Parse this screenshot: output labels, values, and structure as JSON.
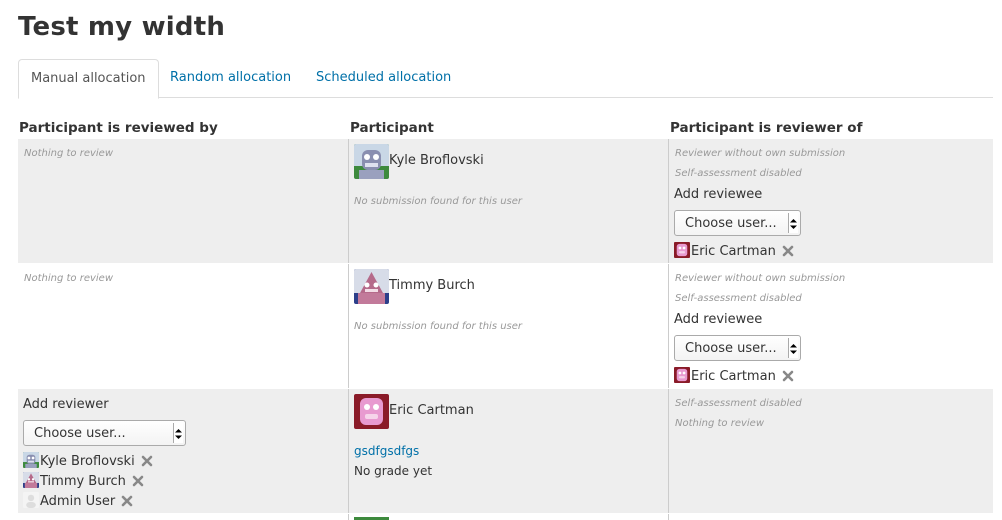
{
  "page": {
    "title": "Test my width"
  },
  "tabs": [
    {
      "label": "Manual allocation",
      "active": true
    },
    {
      "label": "Random allocation",
      "active": false
    },
    {
      "label": "Scheduled allocation",
      "active": false
    }
  ],
  "headers": {
    "reviewed_by": "Participant is reviewed by",
    "participant": "Participant",
    "reviewer_of": "Participant is reviewer of"
  },
  "rows": [
    {
      "reviewed_by": {
        "note": "Nothing to review"
      },
      "participant": {
        "name": "Kyle Broflovski",
        "submission_note": "No submission found for this user",
        "avatar": "robot-grey-icon"
      },
      "reviewer_of": {
        "notes": [
          "Reviewer without own submission",
          "Self-assessment disabled"
        ],
        "add_label": "Add reviewee",
        "select_value": "Choose user...",
        "assigned": [
          {
            "name": "Eric Cartman",
            "avatar": "robot-pink-icon"
          }
        ]
      }
    },
    {
      "reviewed_by": {
        "note": "Nothing to review"
      },
      "participant": {
        "name": "Timmy Burch",
        "submission_note": "No submission found for this user",
        "avatar": "robot-red-icon"
      },
      "reviewer_of": {
        "notes": [
          "Reviewer without own submission",
          "Self-assessment disabled"
        ],
        "add_label": "Add reviewee",
        "select_value": "Choose user...",
        "assigned": [
          {
            "name": "Eric Cartman",
            "avatar": "robot-pink-icon"
          }
        ]
      }
    },
    {
      "reviewed_by": {
        "add_label": "Add reviewer",
        "select_value": "Choose user...",
        "assigned": [
          {
            "name": "Kyle Broflovski",
            "avatar": "robot-grey-icon"
          },
          {
            "name": "Timmy Burch",
            "avatar": "robot-red-icon"
          },
          {
            "name": "Admin User",
            "avatar": "default-user-icon"
          }
        ]
      },
      "participant": {
        "name": "Eric Cartman",
        "submission_link": "gsdfgsdfgs",
        "grade": "No grade yet",
        "avatar": "robot-pink-icon"
      },
      "reviewer_of": {
        "notes": [
          "Self-assessment disabled",
          "Nothing to review"
        ]
      }
    }
  ],
  "colors": {
    "link": "#0070a8",
    "shaded_row": "#eeeeee",
    "note": "#999999"
  }
}
